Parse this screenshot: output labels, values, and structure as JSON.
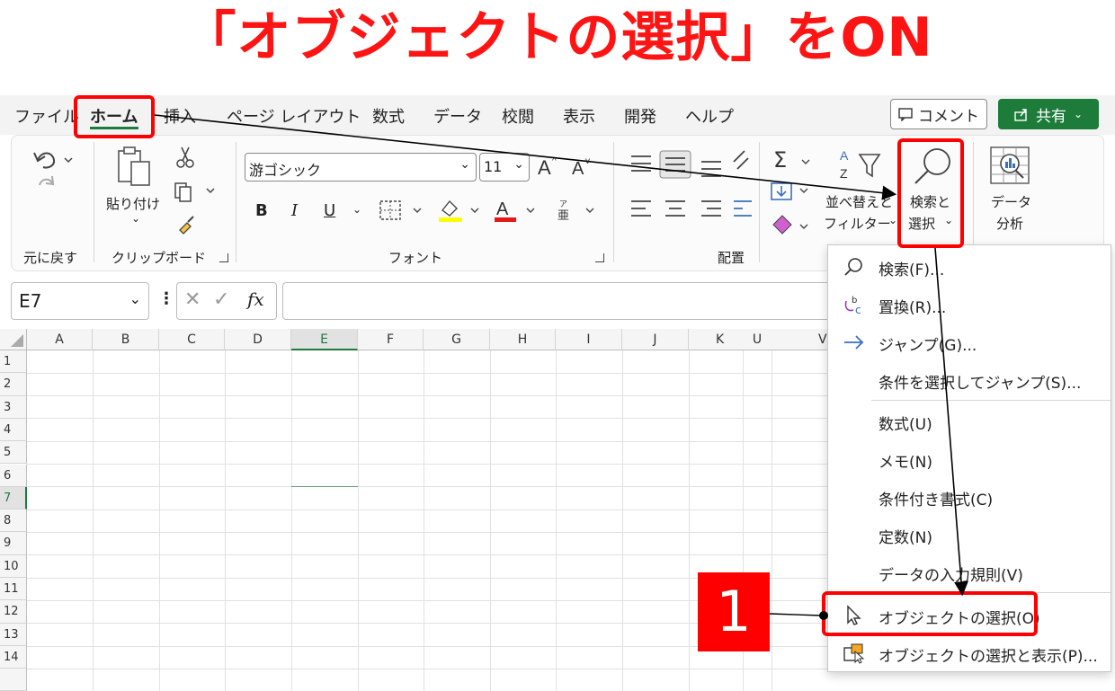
{
  "headline": "「オブジェクトの選択」をON",
  "tabs": {
    "file": "ファイル",
    "home": "ホーム",
    "insert": "挿入",
    "page_layout": "ページ レイアウト",
    "formulas": "数式",
    "data": "データ",
    "review": "校閲",
    "view": "表示",
    "developer": "開発",
    "help": "ヘルプ"
  },
  "actions": {
    "comment": "コメント",
    "share": "共有"
  },
  "ribbon": {
    "undo_group": "元に戻す",
    "clipboard_group": "クリップボード",
    "paste": "貼り付け",
    "font_group": "フォント",
    "font_name": "游ゴシック",
    "font_size": "11",
    "bold": "B",
    "italic": "I",
    "underline": "U",
    "align_group": "配置",
    "sort_filter_line1": "並べ替えと",
    "sort_filter_line2": "フィルター",
    "find_select_line1": "検索と",
    "find_select_line2": "選択",
    "analyze_line1": "データ",
    "analyze_line2": "分析"
  },
  "formula_bar": {
    "name_box": "E7",
    "fx": "fx"
  },
  "grid": {
    "columns": [
      "A",
      "B",
      "C",
      "D",
      "E",
      "F",
      "G",
      "H",
      "I",
      "J",
      "K",
      "U",
      "V"
    ],
    "rows": [
      "1",
      "2",
      "3",
      "4",
      "5",
      "6",
      "7",
      "8",
      "9",
      "10",
      "11",
      "12",
      "13",
      "14"
    ],
    "selected_column": "E",
    "selected_row": "7"
  },
  "menu": {
    "items": [
      {
        "label": "検索(F)...",
        "icon": "search-icon"
      },
      {
        "label": "置換(R)...",
        "icon": "replace-icon"
      },
      {
        "label": "ジャンプ(G)...",
        "icon": "arrow-right-icon"
      },
      {
        "label": "条件を選択してジャンプ(S)...",
        "icon": ""
      },
      {
        "label": "数式(U)",
        "icon": ""
      },
      {
        "label": "メモ(N)",
        "icon": ""
      },
      {
        "label": "条件付き書式(C)",
        "icon": ""
      },
      {
        "label": "定数(N)",
        "icon": ""
      },
      {
        "label": "データの入力規則(V)",
        "icon": ""
      },
      {
        "label": "オブジェクトの選択(O)",
        "icon": "cursor-arrow-icon"
      },
      {
        "label": "オブジェクトの選択と表示(P)...",
        "icon": "selection-pane-icon"
      }
    ]
  },
  "annotation": {
    "step_number": "1",
    "accent_color": "#ff0000"
  }
}
